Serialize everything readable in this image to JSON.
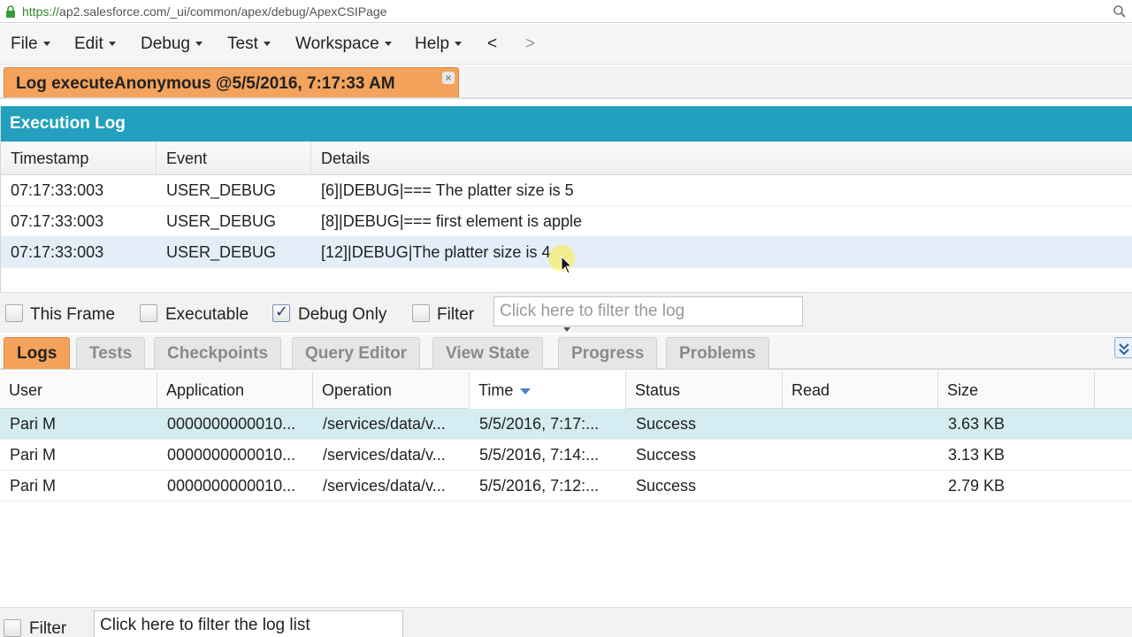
{
  "browser": {
    "url_scheme": "https://",
    "url_rest": "ap2.salesforce.com/_ui/common/apex/debug/ApexCSIPage"
  },
  "menubar": {
    "items": [
      {
        "label": "File"
      },
      {
        "label": "Edit"
      },
      {
        "label": "Debug"
      },
      {
        "label": "Test"
      },
      {
        "label": "Workspace"
      },
      {
        "label": "Help"
      }
    ],
    "back": "<",
    "forward": ">"
  },
  "doc_tab": {
    "label": "Log executeAnonymous @5/5/2016, 7:17:33 AM",
    "close": "×"
  },
  "execution_log": {
    "title": "Execution Log",
    "columns": [
      "Timestamp",
      "Event",
      "Details"
    ],
    "rows": [
      {
        "timestamp": "07:17:33:003",
        "event": "USER_DEBUG",
        "details": "[6]|DEBUG|=== The platter size is 5"
      },
      {
        "timestamp": "07:17:33:003",
        "event": "USER_DEBUG",
        "details": "[8]|DEBUG|=== first element is apple"
      },
      {
        "timestamp": "07:17:33:003",
        "event": "USER_DEBUG",
        "details": "[12]|DEBUG|The platter size is 4"
      }
    ],
    "filters": {
      "this_frame": {
        "label": "This Frame",
        "checked": false
      },
      "executable": {
        "label": "Executable",
        "checked": false
      },
      "debug_only": {
        "label": "Debug Only",
        "checked": true
      },
      "filter": {
        "label": "Filter",
        "checked": false
      },
      "placeholder": "Click here to filter the log"
    }
  },
  "bottom_tabs": [
    {
      "label": "Logs",
      "active": true
    },
    {
      "label": "Tests"
    },
    {
      "label": "Checkpoints"
    },
    {
      "label": "Query Editor"
    },
    {
      "label": "View State"
    },
    {
      "label": "Progress"
    },
    {
      "label": "Problems"
    }
  ],
  "logs": {
    "columns": [
      "User",
      "Application",
      "Operation",
      "Time",
      "Status",
      "Read",
      "Size"
    ],
    "sorted_column": "Time",
    "rows": [
      {
        "user": "Pari M",
        "application": "0000000000010...",
        "operation": "/services/data/v...",
        "time": "5/5/2016, 7:17:...",
        "status": "Success",
        "read": "",
        "size": "3.63 KB"
      },
      {
        "user": "Pari M",
        "application": "0000000000010...",
        "operation": "/services/data/v...",
        "time": "5/5/2016, 7:14:...",
        "status": "Success",
        "read": "",
        "size": "3.13 KB"
      },
      {
        "user": "Pari M",
        "application": "0000000000010...",
        "operation": "/services/data/v...",
        "time": "5/5/2016, 7:12:...",
        "status": "Success",
        "read": "",
        "size": "2.79 KB"
      }
    ],
    "filter": {
      "label": "Filter",
      "checked": false,
      "value": "Click here to filter the log list"
    }
  },
  "colors": {
    "accent_orange": "#f3a35c",
    "header_teal": "#23a0bd"
  }
}
